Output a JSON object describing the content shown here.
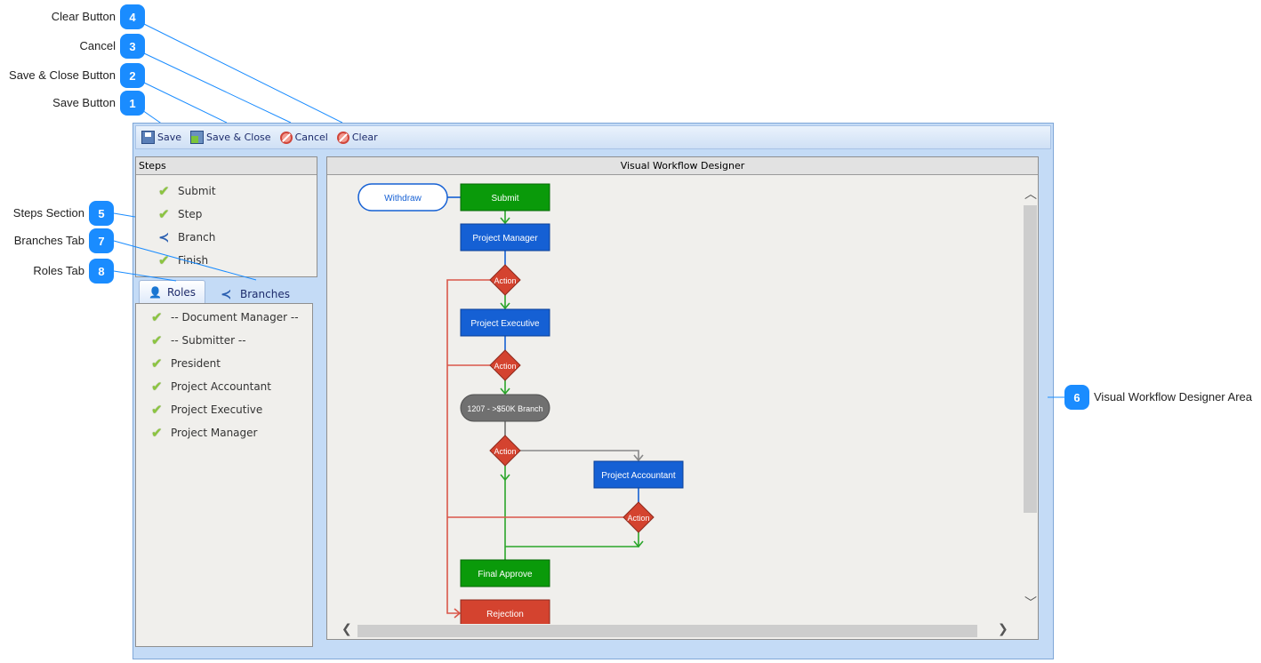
{
  "callouts": [
    {
      "number": "1",
      "label": "Save Button"
    },
    {
      "number": "2",
      "label": "Save & Close Button"
    },
    {
      "number": "3",
      "label": "Cancel"
    },
    {
      "number": "4",
      "label": "Clear Button"
    },
    {
      "number": "5",
      "label": "Steps Section"
    },
    {
      "number": "6",
      "label": "Visual Workflow Designer Area"
    },
    {
      "number": "7",
      "label": "Branches Tab"
    },
    {
      "number": "8",
      "label": "Roles Tab"
    }
  ],
  "callout_color": "#1a8cff",
  "toolbar": {
    "save": "Save",
    "save_close": "Save & Close",
    "cancel": "Cancel",
    "clear": "Clear"
  },
  "steps": {
    "title": "Steps",
    "items": [
      {
        "label": "Submit",
        "icon": "check-icon"
      },
      {
        "label": "Step",
        "icon": "check-icon"
      },
      {
        "label": "Branch",
        "icon": "branch-icon"
      },
      {
        "label": "Finish",
        "icon": "check-icon"
      }
    ]
  },
  "tabs": {
    "roles": "Roles",
    "branches": "Branches",
    "active": "Roles"
  },
  "roles": [
    "-- Document Manager --",
    "-- Submitter --",
    "President",
    "Project Accountant",
    "Project Executive",
    "Project Manager"
  ],
  "designer": {
    "title": "Visual Workflow Designer",
    "nodes": {
      "withdraw": "Withdraw",
      "submit": "Submit",
      "project_manager": "Project Manager",
      "action1": "Action",
      "project_executive": "Project Executive",
      "action2": "Action",
      "branch": "1207 - >$50K Branch",
      "action3": "Action",
      "project_accountant": "Project Accountant",
      "action4": "Action",
      "final_approve": "Final Approve",
      "rejection": "Rejection"
    },
    "colors": {
      "submit": "#0a9a0a",
      "step": "#1560d4",
      "action": "#d4432f",
      "branch": "#707070",
      "reject": "#d4432f",
      "approve_line": "#2aa52a",
      "reject_line": "#d9574a"
    }
  }
}
